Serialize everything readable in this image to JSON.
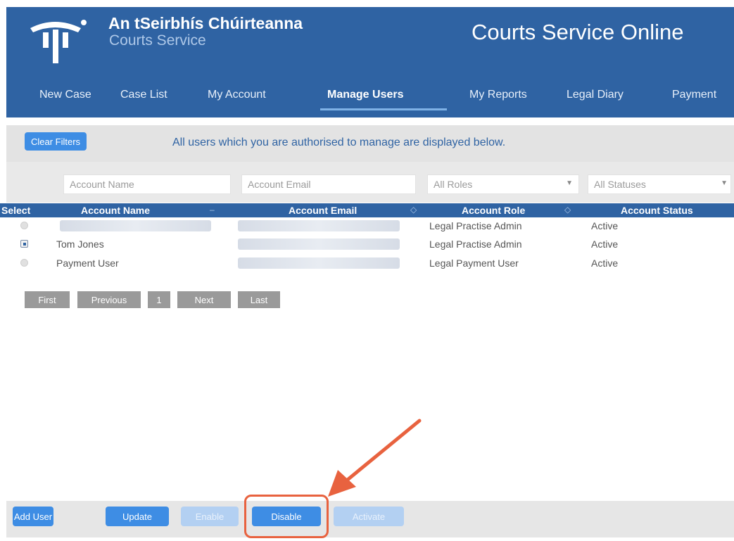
{
  "header": {
    "brand_irish": "An tSeirbhís Chúirteanna",
    "brand_english": "Courts Service",
    "product_title": "Courts Service Online"
  },
  "nav": {
    "items": [
      "New Case",
      "Case List",
      "My Account",
      "Manage Users",
      "My Reports",
      "Legal Diary",
      "Payment"
    ],
    "active": "Manage Users"
  },
  "toolbar": {
    "clear_filters_label": "Clear Filters",
    "info_message": "All users which you are authorised to manage are displayed below."
  },
  "filters": {
    "account_name_placeholder": "Account Name",
    "account_email_placeholder": "Account Email",
    "roles_selected": "All Roles",
    "statuses_selected": "All Statuses"
  },
  "table": {
    "headers": [
      "Select",
      "Account Name",
      "Account Email",
      "Account Role",
      "Account Status"
    ],
    "rows": [
      {
        "name": "",
        "email": "",
        "role": "Legal Practise Admin",
        "status": "Active",
        "selected": false
      },
      {
        "name": "Tom Jones",
        "email": "",
        "role": "Legal Practise Admin",
        "status": "Active",
        "selected": true
      },
      {
        "name": "Payment User",
        "email": "",
        "role": "Legal Payment User",
        "status": "Active",
        "selected": false
      }
    ]
  },
  "pager": {
    "first": "First",
    "previous": "Previous",
    "page": "1",
    "next": "Next",
    "last": "Last"
  },
  "actions": {
    "add_user": "Add User",
    "update": "Update",
    "enable": "Enable",
    "disable": "Disable",
    "activate": "Activate"
  },
  "colors": {
    "header_blue": "#2f63a3",
    "button_blue": "#3e8de4",
    "annotation_orange": "#e8623f"
  }
}
